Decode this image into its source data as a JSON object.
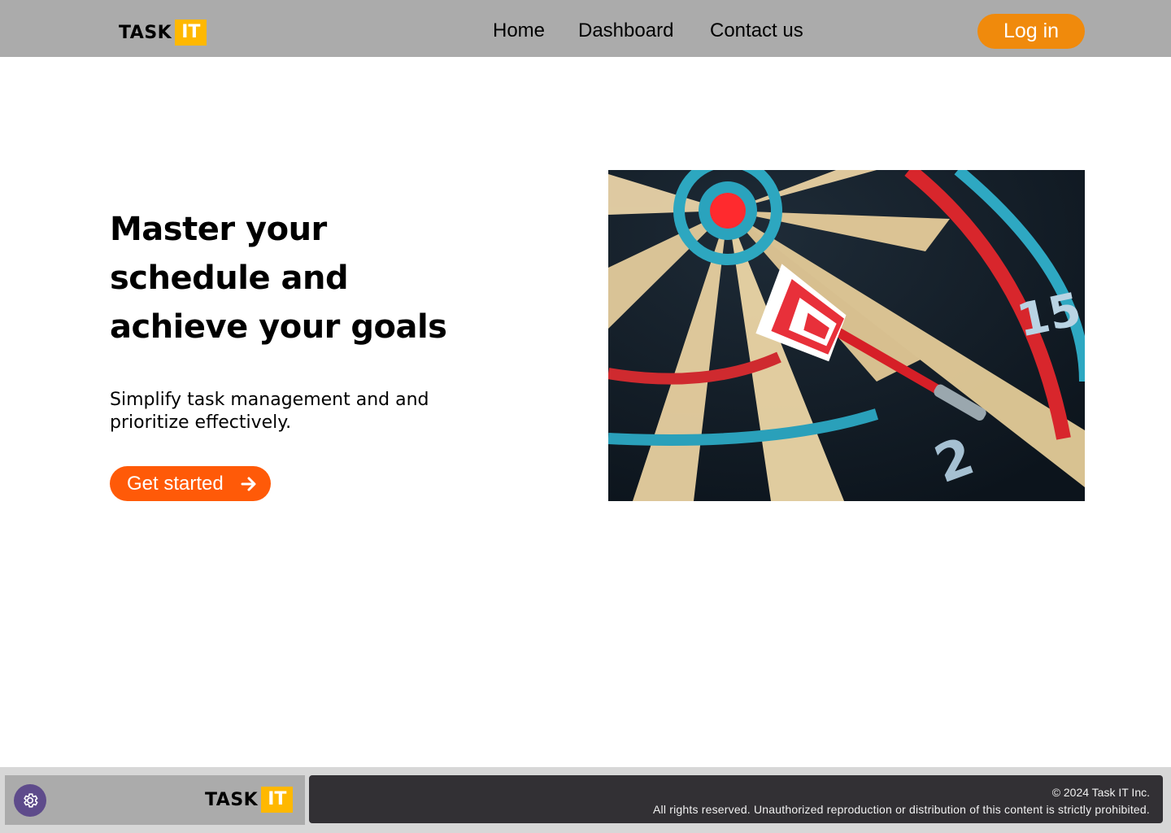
{
  "header": {
    "logo": {
      "word": "TASK",
      "badge": "IT"
    },
    "nav": [
      {
        "label": "Home"
      },
      {
        "label": "Dashboard"
      },
      {
        "label": "Contact us"
      }
    ],
    "login_label": "Log in"
  },
  "hero": {
    "title_lines": [
      "Master your",
      "schedule and",
      "achieve your goals"
    ],
    "subtitle": "Simplify task management and and prioritize effectively.",
    "cta_label": "Get started",
    "image": {
      "subject": "dart hitting dartboard",
      "visible_numbers": [
        "15",
        "2"
      ]
    }
  },
  "footer": {
    "logo": {
      "word": "TASK",
      "badge": "IT"
    },
    "copyright": "© 2024 Task IT Inc.",
    "rights": "All rights reserved. Unauthorized reproduction or distribution of this content is strictly prohibited."
  },
  "icons": {
    "cta_arrow": "arrow-right-icon",
    "settings": "gear-icon"
  },
  "colors": {
    "header_bg": "#ababab",
    "login_bg": "#f08a0c",
    "cta_bg": "#ff5a08",
    "logo_badge": "#ffb800",
    "footer_dark": "#323034",
    "settings_bg": "#5e4b8b"
  }
}
